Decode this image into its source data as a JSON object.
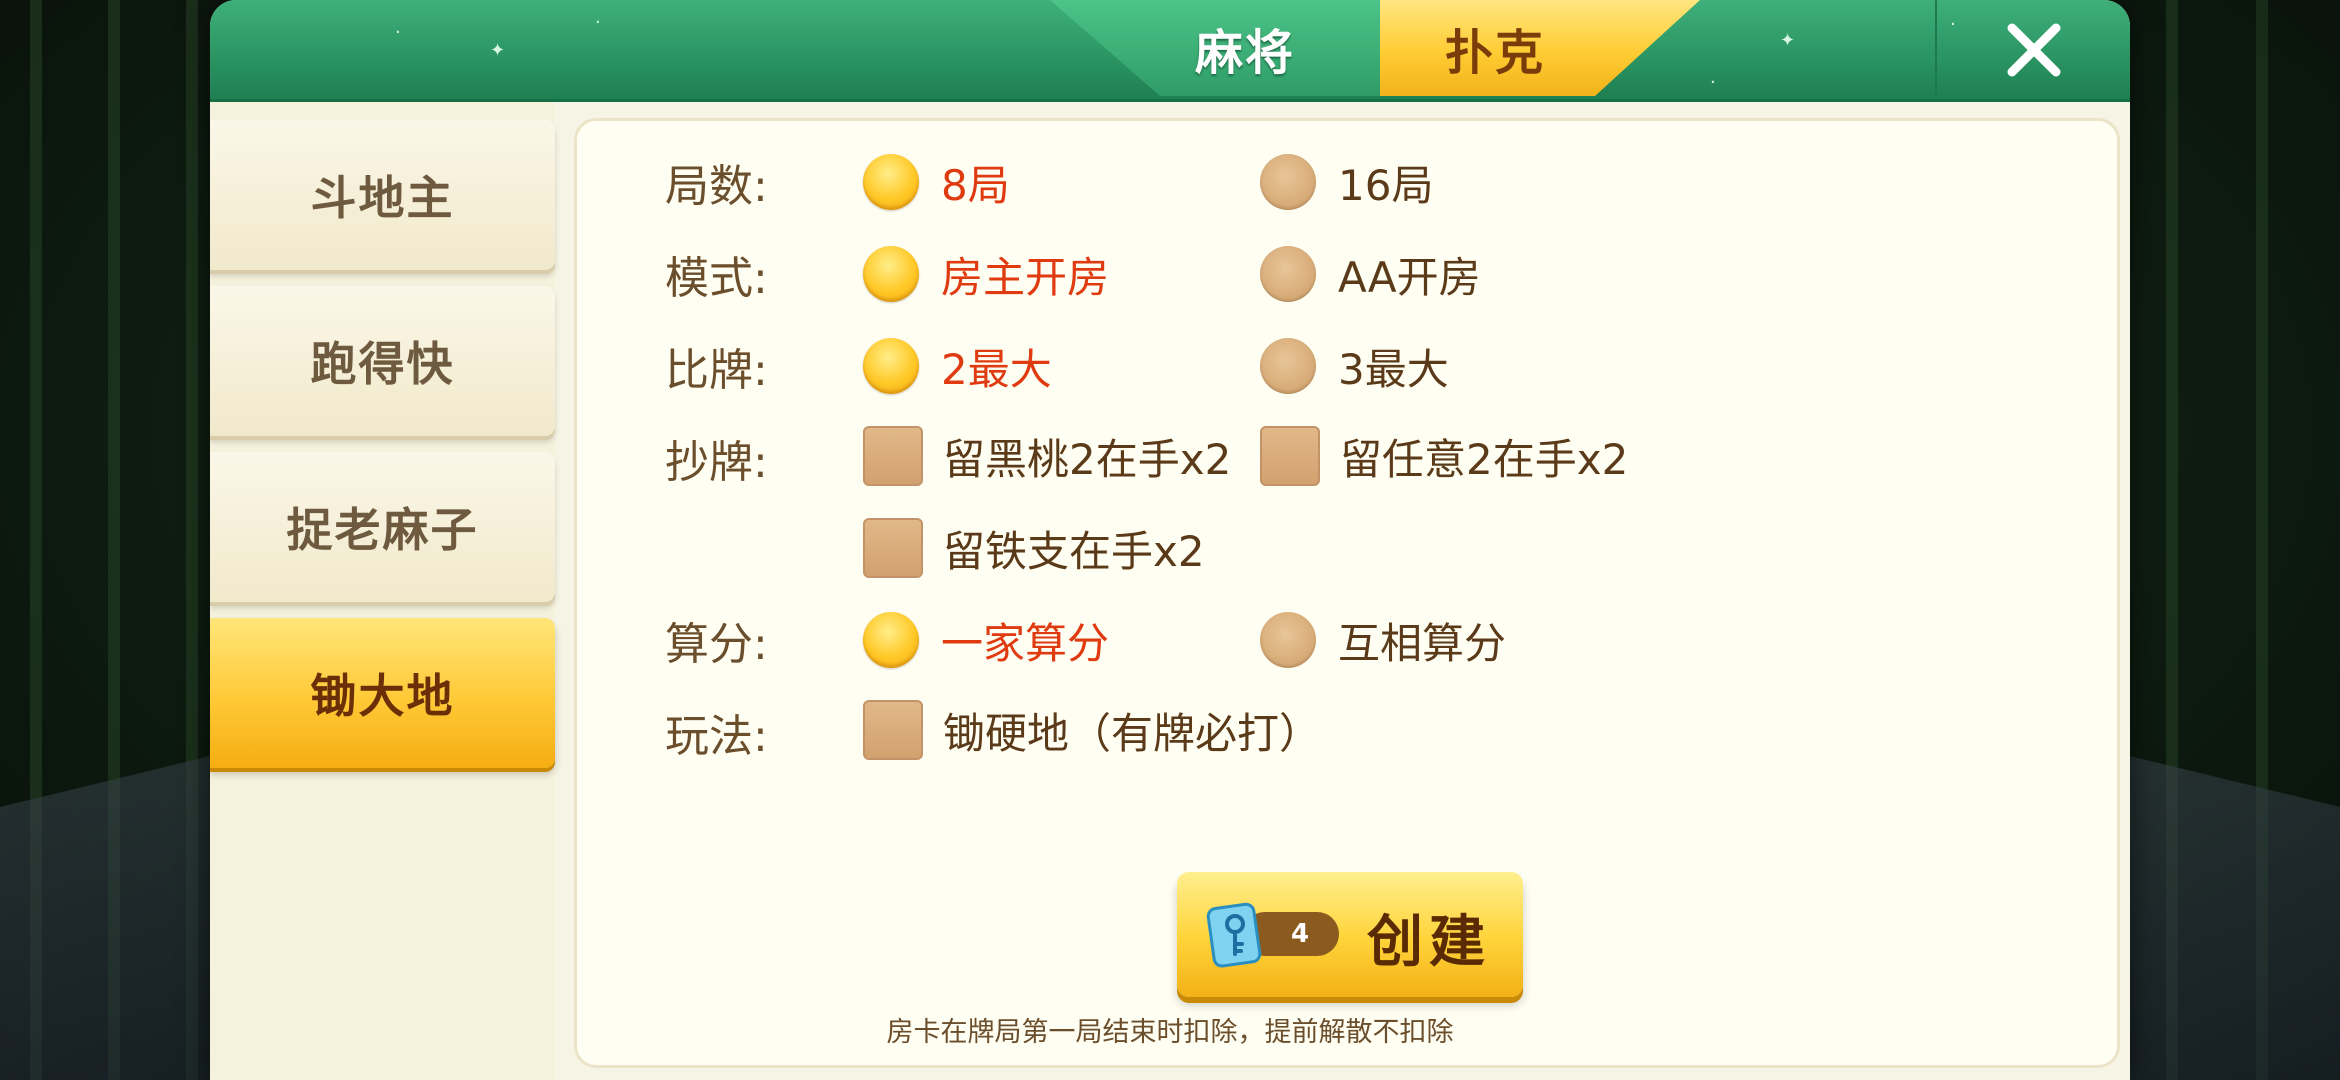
{
  "header": {
    "tabs": [
      {
        "label": "麻将",
        "active": false
      },
      {
        "label": "扑克",
        "active": true
      }
    ],
    "close_icon": "close-icon"
  },
  "sidebar": {
    "items": [
      {
        "label": "斗地主",
        "active": false
      },
      {
        "label": "跑得快",
        "active": false
      },
      {
        "label": "捉老麻子",
        "active": false
      },
      {
        "label": "锄大地",
        "active": true
      }
    ]
  },
  "settings": {
    "rounds": {
      "label": "局数:",
      "options": [
        {
          "label": "8局",
          "selected": true
        },
        {
          "label": "16局",
          "selected": false
        }
      ]
    },
    "mode": {
      "label": "模式:",
      "options": [
        {
          "label": "房主开房",
          "selected": true
        },
        {
          "label": "AA开房",
          "selected": false
        }
      ]
    },
    "compare": {
      "label": "比牌:",
      "options": [
        {
          "label": "2最大",
          "selected": true
        },
        {
          "label": "3最大",
          "selected": false
        }
      ]
    },
    "copy": {
      "label": "抄牌:",
      "options": [
        {
          "label": "留黑桃2在手x2",
          "checked": false
        },
        {
          "label": "留任意2在手x2",
          "checked": false
        },
        {
          "label": "留铁支在手x2",
          "checked": false
        }
      ]
    },
    "scoring": {
      "label": "算分:",
      "options": [
        {
          "label": "一家算分",
          "selected": true
        },
        {
          "label": "互相算分",
          "selected": false
        }
      ]
    },
    "play": {
      "label": "玩法:",
      "options": [
        {
          "label": "锄硬地（有牌必打）",
          "checked": false
        }
      ]
    }
  },
  "create": {
    "label": "创建",
    "card_count": "4",
    "note": "房卡在牌局第一局结束时扣除，提前解散不扣除"
  },
  "colors": {
    "header_green": "#2a9462",
    "accent_gold": "#ffcc33",
    "selected_text": "#e03a10",
    "label_brown": "#6b4e2c"
  }
}
